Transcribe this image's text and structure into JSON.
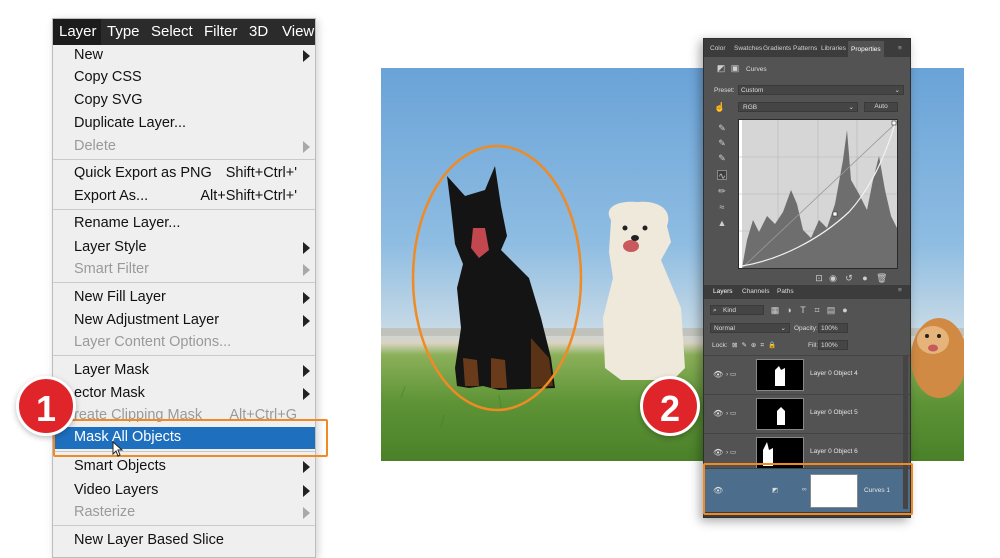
{
  "menu": {
    "menubar": [
      "Layer",
      "Type",
      "Select",
      "Filter",
      "3D",
      "View"
    ],
    "items": [
      {
        "label": "New",
        "shortcut": "",
        "submenu": true,
        "disabled": false
      },
      {
        "label": "Copy CSS",
        "shortcut": "",
        "submenu": false,
        "disabled": false
      },
      {
        "label": "Copy SVG",
        "shortcut": "",
        "submenu": false,
        "disabled": false
      },
      {
        "label": "Duplicate Layer...",
        "shortcut": "",
        "submenu": false,
        "disabled": false
      },
      {
        "label": "Delete",
        "shortcut": "",
        "submenu": true,
        "disabled": true
      },
      {
        "label": "Quick Export as PNG",
        "shortcut": "Shift+Ctrl+'",
        "submenu": false,
        "disabled": false
      },
      {
        "label": "Export As...",
        "shortcut": "Alt+Shift+Ctrl+'",
        "submenu": false,
        "disabled": false
      },
      {
        "label": "Rename Layer...",
        "shortcut": "",
        "submenu": false,
        "disabled": false
      },
      {
        "label": "Layer Style",
        "shortcut": "",
        "submenu": true,
        "disabled": false
      },
      {
        "label": "Smart Filter",
        "shortcut": "",
        "submenu": true,
        "disabled": true
      },
      {
        "label": "New Fill Layer",
        "shortcut": "",
        "submenu": true,
        "disabled": false
      },
      {
        "label": "New Adjustment Layer",
        "shortcut": "",
        "submenu": true,
        "disabled": false
      },
      {
        "label": "Layer Content Options...",
        "shortcut": "",
        "submenu": false,
        "disabled": true
      },
      {
        "label": "Layer Mask",
        "shortcut": "",
        "submenu": true,
        "disabled": false
      },
      {
        "label": "ector Mask",
        "shortcut": "",
        "submenu": true,
        "disabled": false
      },
      {
        "label": "reate Clipping Mask",
        "shortcut": "Alt+Ctrl+G",
        "submenu": false,
        "disabled": true
      },
      {
        "label": "Mask All Objects",
        "shortcut": "",
        "submenu": false,
        "disabled": false,
        "highlighted": true
      },
      {
        "label": "Smart Objects",
        "shortcut": "",
        "submenu": true,
        "disabled": false
      },
      {
        "label": "Video Layers",
        "shortcut": "",
        "submenu": true,
        "disabled": false
      },
      {
        "label": "Rasterize",
        "shortcut": "",
        "submenu": true,
        "disabled": true
      },
      {
        "label": "New Layer Based Slice",
        "shortcut": "",
        "submenu": false,
        "disabled": false
      }
    ]
  },
  "badges": {
    "step1": "1",
    "step2": "2"
  },
  "panel": {
    "tabs": [
      "Color",
      "Swatches",
      "Gradients",
      "Patterns",
      "Libraries",
      "Properties"
    ],
    "properties_title": "Curves",
    "preset_label": "Preset:",
    "preset_value": "Custom",
    "channel_value": "RGB",
    "auto_label": "Auto",
    "layer_tabs": [
      "Layers",
      "Channels",
      "Paths"
    ],
    "kind_label": "Kind",
    "blend_mode": "Normal",
    "opacity_label": "Opacity:",
    "opacity_value": "100%",
    "lock_label": "Lock:",
    "fill_label": "Fill:",
    "fill_value": "100%",
    "layers": [
      {
        "name": "Layer 0 Object 4"
      },
      {
        "name": "Layer 0 Object 5"
      },
      {
        "name": "Layer 0 Object 6"
      },
      {
        "name": "Curves 1",
        "selected": true
      }
    ]
  },
  "colors": {
    "highlight": "#1f6fbf",
    "callout": "#f08a24",
    "badge": "#e0252a"
  }
}
